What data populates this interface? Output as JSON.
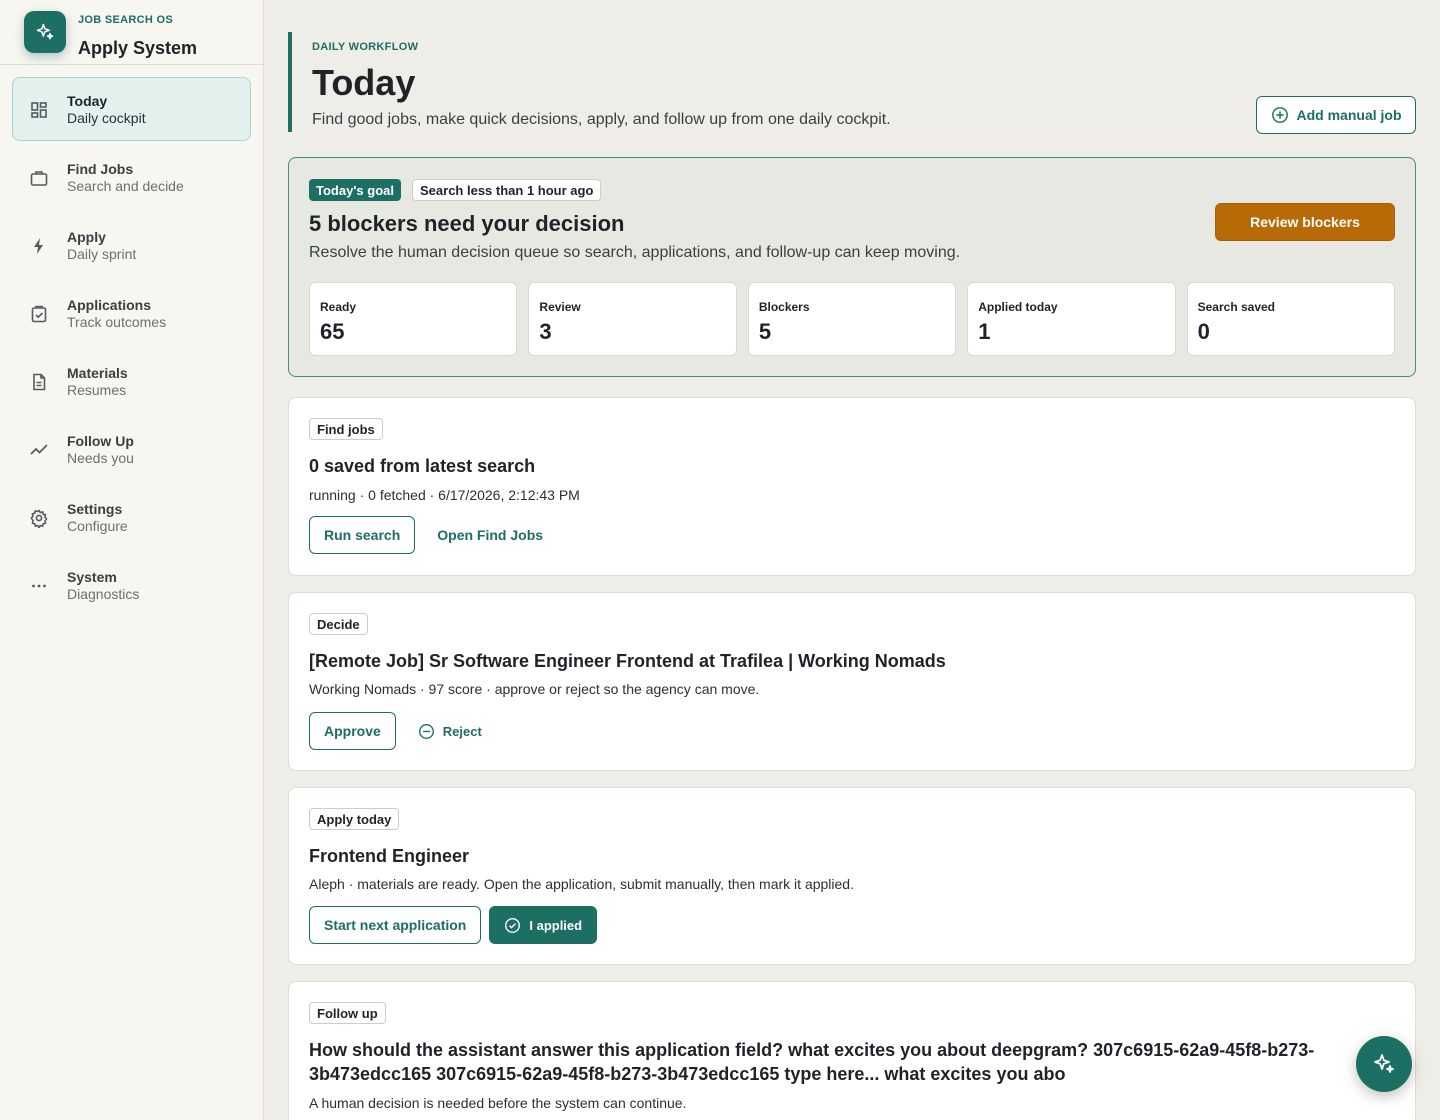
{
  "brand": {
    "eyebrow": "JOB SEARCH OS",
    "title": "Apply System"
  },
  "sidebar": {
    "items": [
      {
        "label": "Today",
        "sub": "Daily cockpit",
        "icon": "dashboard-icon",
        "active": true
      },
      {
        "label": "Find Jobs",
        "sub": "Search and decide",
        "icon": "briefcase-icon"
      },
      {
        "label": "Apply",
        "sub": "Daily sprint",
        "icon": "lightning-icon"
      },
      {
        "label": "Applications",
        "sub": "Track outcomes",
        "icon": "clipboard-check-icon"
      },
      {
        "label": "Materials",
        "sub": "Resumes",
        "icon": "document-icon"
      },
      {
        "label": "Follow Up",
        "sub": "Needs you",
        "icon": "trend-line-icon"
      },
      {
        "label": "Settings",
        "sub": "Configure",
        "icon": "gear-icon"
      },
      {
        "label": "System",
        "sub": "Diagnostics",
        "icon": "more-icon"
      }
    ]
  },
  "header": {
    "eyebrow": "DAILY WORKFLOW",
    "title": "Today",
    "description": "Find good jobs, make quick decisions, apply, and follow up from one daily cockpit.",
    "add_job_label": "Add manual job"
  },
  "goal": {
    "badge": "Today's goal",
    "search_status": "Search less than 1 hour ago",
    "title": "5 blockers need your decision",
    "description": "Resolve the human decision queue so search, applications, and follow-up can keep moving.",
    "review_label": "Review blockers",
    "stats": [
      {
        "label": "Ready",
        "value": "65"
      },
      {
        "label": "Review",
        "value": "3"
      },
      {
        "label": "Blockers",
        "value": "5"
      },
      {
        "label": "Applied today",
        "value": "1"
      },
      {
        "label": "Search saved",
        "value": "0"
      }
    ]
  },
  "cards": {
    "find": {
      "badge": "Find jobs",
      "title": "0 saved from latest search",
      "meta": "running · 0 fetched · 6/17/2026, 2:12:43 PM",
      "primary": "Run search",
      "secondary": "Open Find Jobs"
    },
    "decide": {
      "badge": "Decide",
      "title": "[Remote Job] Sr Software Engineer Frontend at Trafilea | Working Nomads",
      "meta": "Working Nomads · 97 score · approve or reject so the agency can move.",
      "primary": "Approve",
      "secondary": "Reject"
    },
    "apply": {
      "badge": "Apply today",
      "title": "Frontend Engineer",
      "meta": "Aleph · materials are ready. Open the application, submit manually, then mark it applied.",
      "primary": "Start next application",
      "secondary": "I applied"
    },
    "follow": {
      "badge": "Follow up",
      "title_line1": "How should the assistant answer this application field? what excites you about deepgram? 307c6915-62a9-45f8-b273-",
      "title_line2": "3b473edcc165 307c6915-62a9-45f8-b273-3b473edcc165 type here... what excites you abo",
      "meta": "A human decision is needed before the system can continue."
    }
  },
  "colors": {
    "accent": "#1d6e63",
    "warning": "#b86a07",
    "active_bg": "#e3f1ee"
  }
}
